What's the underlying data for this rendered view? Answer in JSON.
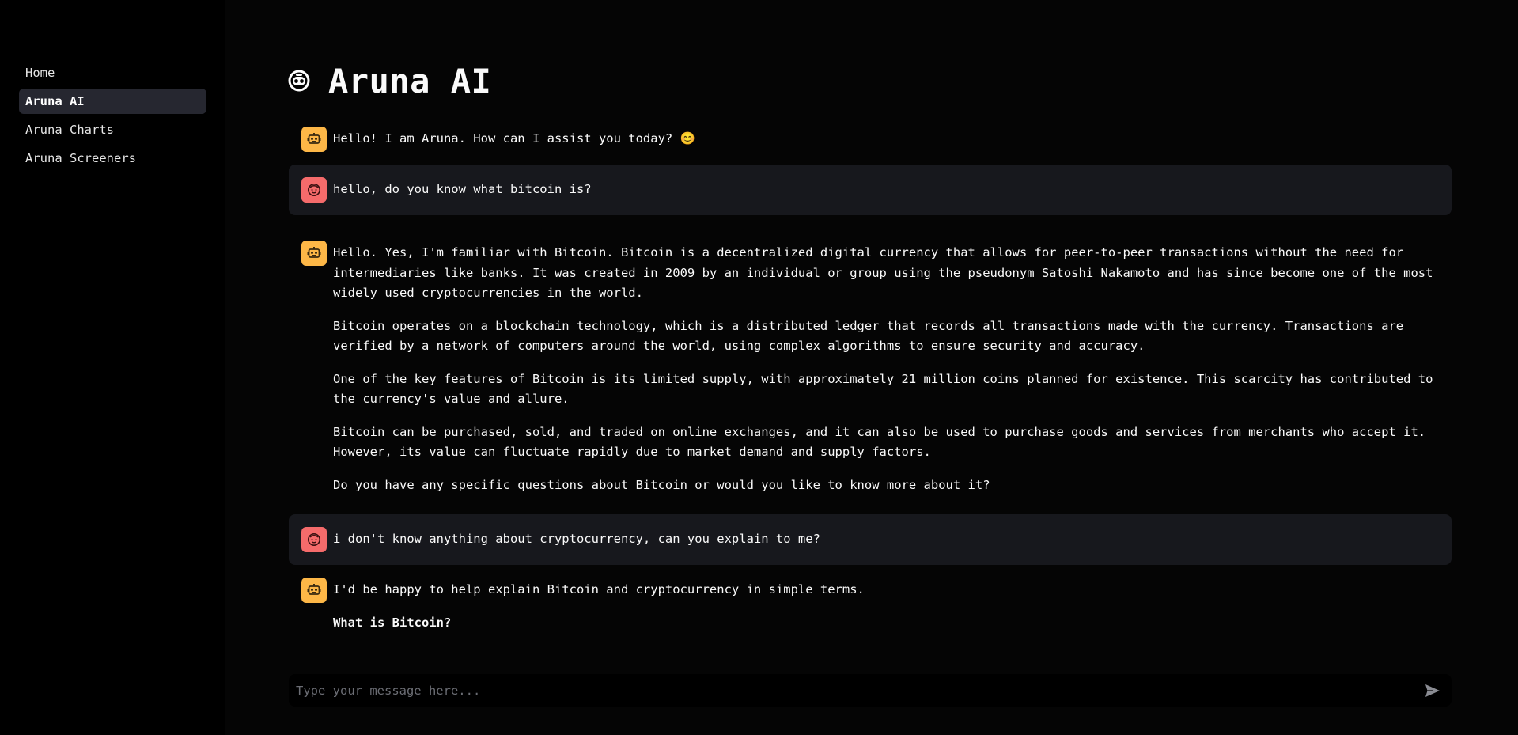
{
  "sidebar": {
    "items": [
      {
        "label": "Home",
        "active": false
      },
      {
        "label": "Aruna AI",
        "active": true
      },
      {
        "label": "Aruna Charts",
        "active": false
      },
      {
        "label": "Aruna Screeners",
        "active": false
      }
    ]
  },
  "header": {
    "title": "Aruna AI",
    "icon": "robot-face-icon"
  },
  "messages": [
    {
      "role": "assistant",
      "paragraphs": [
        "Hello! I am Aruna. How can I assist you today? 😊"
      ]
    },
    {
      "role": "user",
      "paragraphs": [
        "hello, do you know what bitcoin is?"
      ]
    },
    {
      "role": "assistant",
      "paragraphs": [
        "Hello. Yes, I'm familiar with Bitcoin. Bitcoin is a decentralized digital currency that allows for peer-to-peer transactions without the need for intermediaries like banks. It was created in 2009 by an individual or group using the pseudonym Satoshi Nakamoto and has since become one of the most widely used cryptocurrencies in the world.",
        "Bitcoin operates on a blockchain technology, which is a distributed ledger that records all transactions made with the currency. Transactions are verified by a network of computers around the world, using complex algorithms to ensure security and accuracy.",
        "One of the key features of Bitcoin is its limited supply, with approximately 21 million coins planned for existence. This scarcity has contributed to the currency's value and allure.",
        "Bitcoin can be purchased, sold, and traded on online exchanges, and it can also be used to purchase goods and services from merchants who accept it. However, its value can fluctuate rapidly due to market demand and supply factors.",
        "Do you have any specific questions about Bitcoin or would you like to know more about it?"
      ]
    },
    {
      "role": "user",
      "paragraphs": [
        "i don't know anything about cryptocurrency, can you explain to me?"
      ]
    },
    {
      "role": "assistant",
      "paragraphs": [
        "I'd be happy to help explain Bitcoin and cryptocurrency in simple terms."
      ],
      "heading": "What is Bitcoin?"
    }
  ],
  "input": {
    "placeholder": "Type your message here...",
    "value": ""
  },
  "colors": {
    "bot_avatar": "#fdb747",
    "user_avatar": "#f56b6b",
    "user_bubble": "#17181d",
    "sidebar_active": "#262730"
  }
}
